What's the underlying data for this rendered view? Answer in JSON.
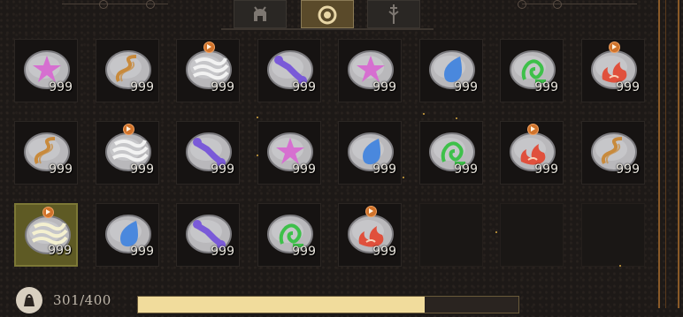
{
  "tabs": [
    {
      "name": "helmet-tab",
      "icon": "helmet-icon",
      "active": false
    },
    {
      "name": "ring-tab",
      "icon": "ring-icon",
      "active": true
    },
    {
      "name": "weapon-tab",
      "icon": "crossed-swords-icon",
      "active": false
    }
  ],
  "inventory": {
    "slots": [
      {
        "glyph": "star",
        "color": "#d66fd0",
        "count": "999",
        "badge": false
      },
      {
        "glyph": "snake",
        "color": "#c88a3c",
        "count": "999",
        "badge": false
      },
      {
        "glyph": "waves",
        "color": "#f2f2f2",
        "count": "999",
        "badge": true
      },
      {
        "glyph": "bone",
        "color": "#7a5ad8",
        "count": "999",
        "badge": false
      },
      {
        "glyph": "star",
        "color": "#d66fd0",
        "count": "999",
        "badge": false
      },
      {
        "glyph": "drop",
        "color": "#4a88dd",
        "count": "999",
        "badge": false
      },
      {
        "glyph": "rune",
        "color": "#3ec04a",
        "count": "999",
        "badge": false
      },
      {
        "glyph": "flame",
        "color": "#e0503c",
        "count": "999",
        "badge": true
      },
      {
        "glyph": "snake",
        "color": "#c88a3c",
        "count": "999",
        "badge": false
      },
      {
        "glyph": "waves",
        "color": "#f2f2f2",
        "count": "999",
        "badge": true
      },
      {
        "glyph": "bone",
        "color": "#7a5ad8",
        "count": "999",
        "badge": false
      },
      {
        "glyph": "star",
        "color": "#d66fd0",
        "count": "999",
        "badge": false
      },
      {
        "glyph": "drop",
        "color": "#4a88dd",
        "count": "999",
        "badge": false
      },
      {
        "glyph": "rune",
        "color": "#3ec04a",
        "count": "999",
        "badge": false
      },
      {
        "glyph": "flame",
        "color": "#e0503c",
        "count": "999",
        "badge": true
      },
      {
        "glyph": "snake",
        "color": "#c88a3c",
        "count": "999",
        "badge": false
      },
      {
        "glyph": "waves",
        "color": "#f4f0d0",
        "count": "999",
        "badge": true,
        "selected": true
      },
      {
        "glyph": "drop",
        "color": "#4a88dd",
        "count": "999",
        "badge": false
      },
      {
        "glyph": "bone",
        "color": "#7a5ad8",
        "count": "999",
        "badge": false
      },
      {
        "glyph": "rune",
        "color": "#3ec04a",
        "count": "999",
        "badge": false
      },
      {
        "glyph": "flame",
        "color": "#e0503c",
        "count": "999",
        "badge": true
      },
      {
        "empty": true
      },
      {
        "empty": true
      },
      {
        "empty": true
      }
    ]
  },
  "footer": {
    "capacity_text": "301/400",
    "capacity_fraction": 0.7525,
    "bag_icon": "bag-icon"
  },
  "colors": {
    "accent_gold": "#f1dc9c",
    "frame_bronze": "#8a5a28",
    "badge_orange": "#d0732b"
  }
}
